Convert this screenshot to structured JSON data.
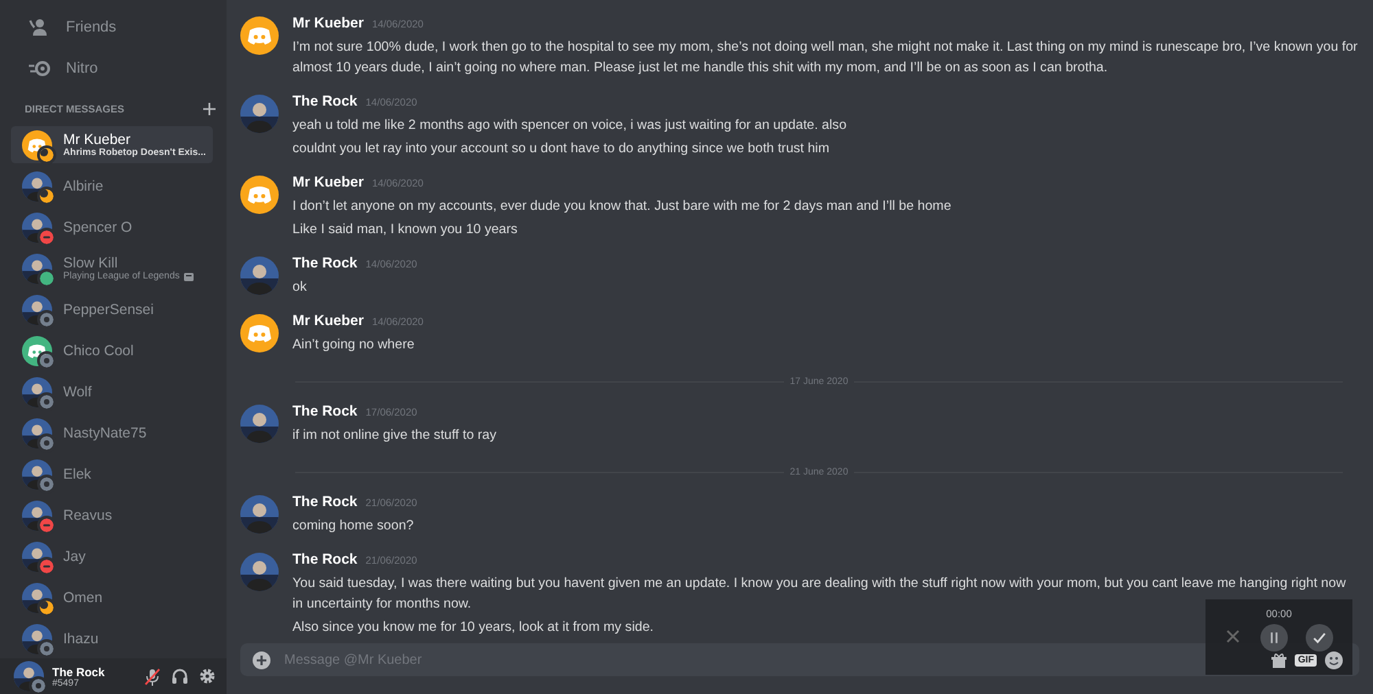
{
  "nav": [
    {
      "kind": "friends",
      "label": "Friends"
    },
    {
      "kind": "nitro",
      "label": "Nitro"
    }
  ],
  "dm_header": {
    "title": "DIRECT MESSAGES"
  },
  "dms": [
    {
      "name": "Mr Kueber",
      "activity": "Ahrims Robetop Doesn't Exis...",
      "avatar": {
        "kind": "logo",
        "color": "#faa61a"
      },
      "status": {
        "kind": "idle",
        "color": "#faa61a"
      },
      "selected": true
    },
    {
      "name": "Albirie",
      "avatar": {
        "kind": "photo"
      },
      "status": {
        "kind": "idle",
        "color": "#faa61a"
      },
      "selected": false
    },
    {
      "name": "Spencer O",
      "avatar": {
        "kind": "photo"
      },
      "status": {
        "kind": "dnd",
        "color": "#f04747"
      },
      "selected": false
    },
    {
      "name": "Slow Kill",
      "activity": "Playing League of Legends",
      "avatar": {
        "kind": "photo"
      },
      "status": {
        "kind": "online",
        "color": "#43b581"
      },
      "selected": false
    },
    {
      "name": "PepperSensei",
      "avatar": {
        "kind": "photo"
      },
      "status": {
        "kind": "offline",
        "color": "#747f8d"
      },
      "selected": false
    },
    {
      "name": "Chico Cool",
      "avatar": {
        "kind": "logo",
        "color": "#43b581"
      },
      "status": {
        "kind": "offline",
        "color": "#747f8d"
      },
      "selected": false
    },
    {
      "name": "Wolf",
      "avatar": {
        "kind": "photo"
      },
      "status": {
        "kind": "offline",
        "color": "#747f8d"
      },
      "selected": false
    },
    {
      "name": "NastyNate75",
      "avatar": {
        "kind": "photo"
      },
      "status": {
        "kind": "offline",
        "color": "#747f8d"
      },
      "selected": false
    },
    {
      "name": "Elek",
      "avatar": {
        "kind": "photo"
      },
      "status": {
        "kind": "offline",
        "color": "#747f8d"
      },
      "selected": false
    },
    {
      "name": "Reavus",
      "avatar": {
        "kind": "photo"
      },
      "status": {
        "kind": "dnd",
        "color": "#f04747"
      },
      "selected": false
    },
    {
      "name": "Jay",
      "avatar": {
        "kind": "photo"
      },
      "status": {
        "kind": "dnd",
        "color": "#f04747"
      },
      "selected": false
    },
    {
      "name": "Omen",
      "avatar": {
        "kind": "photo"
      },
      "status": {
        "kind": "idle",
        "color": "#faa61a"
      },
      "selected": false
    },
    {
      "name": "Ihazu",
      "avatar": {
        "kind": "photo"
      },
      "status": {
        "kind": "offline",
        "color": "#747f8d"
      },
      "selected": false
    }
  ],
  "user_panel": {
    "name": "The Rock",
    "tag": "#5497",
    "status": {
      "kind": "offline",
      "color": "#747f8d"
    },
    "mic_muted": true
  },
  "messages": [
    {
      "kind": "group",
      "author": "Mr Kueber",
      "avatar": {
        "kind": "logo",
        "color": "#faa61a"
      },
      "time": "14/06/2020",
      "lines": [
        "I’m not sure 100% dude, I work then go to the hospital to see my mom, she’s not doing well man, she might not make it. Last thing on my mind is runescape bro, I’ve known you for almost 10 years dude, I ain’t going no where man. Please just let me handle this shit with my mom, and I’ll be on as soon as I can brotha."
      ]
    },
    {
      "kind": "group",
      "author": "The Rock",
      "avatar": {
        "kind": "photo"
      },
      "time": "14/06/2020",
      "lines": [
        "yeah u told me like 2 months ago with spencer on voice, i was just waiting for an update. also",
        "couldnt you let ray into your account so u dont have to do anything since we both trust him"
      ]
    },
    {
      "kind": "group",
      "author": "Mr Kueber",
      "avatar": {
        "kind": "logo",
        "color": "#faa61a"
      },
      "time": "14/06/2020",
      "lines": [
        "I don’t let anyone on my accounts, ever dude you know that. Just bare with me for 2 days man and I’ll be home",
        "Like I said man, I known you 10 years"
      ]
    },
    {
      "kind": "group",
      "author": "The Rock",
      "avatar": {
        "kind": "photo"
      },
      "time": "14/06/2020",
      "lines": [
        "ok"
      ]
    },
    {
      "kind": "group",
      "author": "Mr Kueber",
      "avatar": {
        "kind": "logo",
        "color": "#faa61a"
      },
      "time": "14/06/2020",
      "lines": [
        "Ain’t going no where"
      ]
    },
    {
      "kind": "divider",
      "label": "17 June 2020"
    },
    {
      "kind": "group",
      "author": "The Rock",
      "avatar": {
        "kind": "photo"
      },
      "time": "17/06/2020",
      "lines": [
        "if im not online give the stuff to ray"
      ]
    },
    {
      "kind": "divider",
      "label": "21 June 2020"
    },
    {
      "kind": "group",
      "author": "The Rock",
      "avatar": {
        "kind": "photo"
      },
      "time": "21/06/2020",
      "lines": [
        "coming home soon?"
      ]
    },
    {
      "kind": "group",
      "author": "The Rock",
      "avatar": {
        "kind": "photo"
      },
      "time": "21/06/2020",
      "lines": [
        "You said tuesday, I was there waiting but you havent given me an update. I know you are dealing with the stuff right now with your mom, but you cant leave me hanging right now in uncertainty for months now.",
        "Also since you know me for 10 years, look at it from my side."
      ]
    }
  ],
  "composer": {
    "placeholder": "Message @Mr Kueber",
    "gif": "GIF"
  },
  "recorder": {
    "time": "00:00"
  }
}
